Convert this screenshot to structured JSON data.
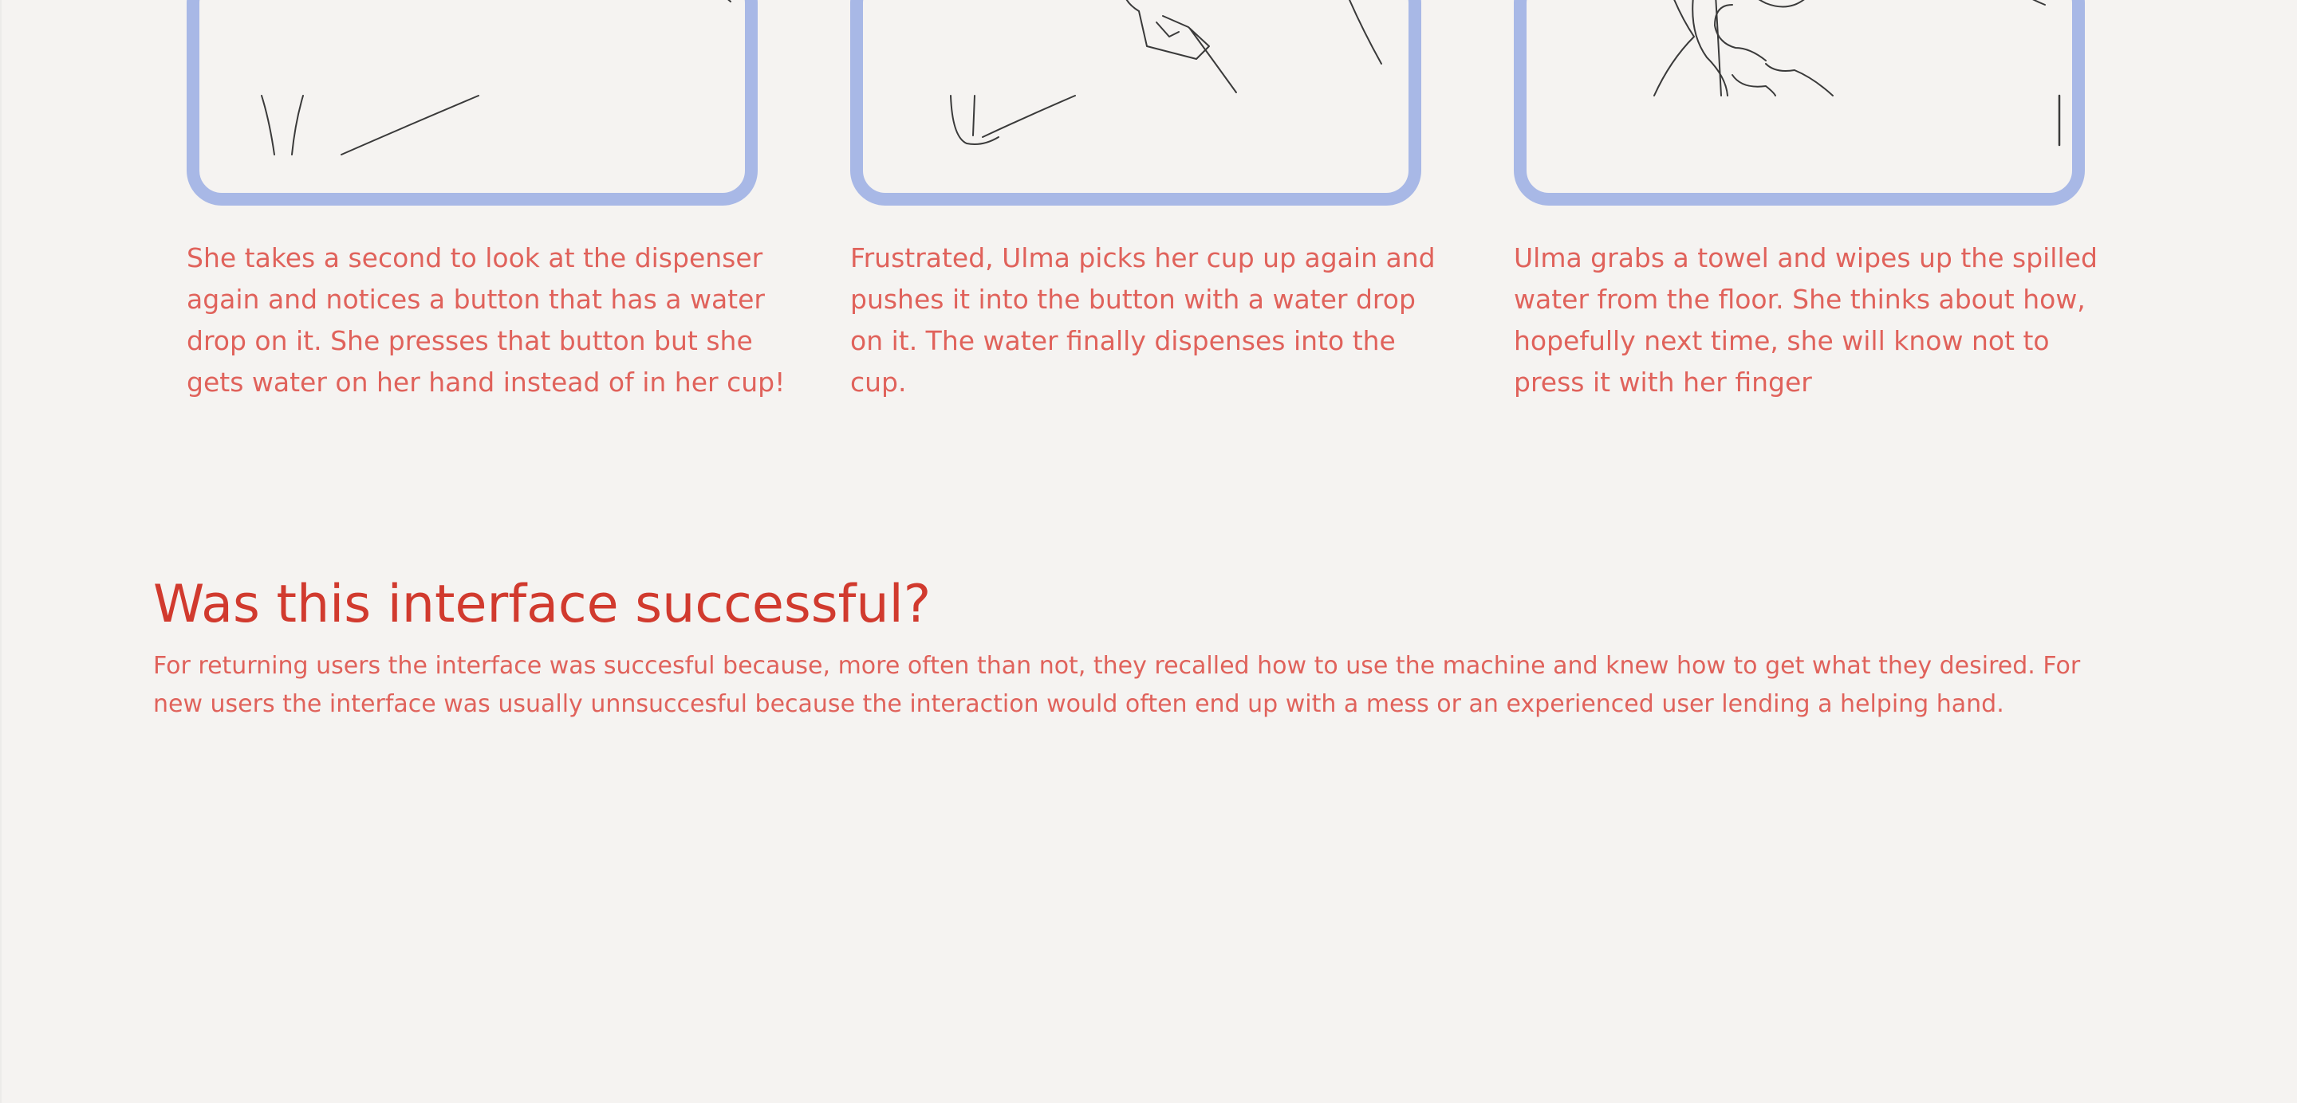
{
  "storyboard": {
    "panels": [
      {
        "caption": "She takes a second to look at the dispenser again and notices a button that has a water drop on it. She presses that button but she gets water on her hand instead of in her cup!"
      },
      {
        "caption": "Frustrated, Ulma picks her cup up again and pushes it into the button with a water drop on it. The water finally dispenses into the cup."
      },
      {
        "caption": "Ulma grabs a towel and wipes up the spilled water from the floor. She thinks about how, hopefully next time, she will know not to press it with her finger"
      }
    ]
  },
  "evaluation": {
    "title": "Was this interface successful?",
    "body": "For returning users the interface was succesful because, more often than not, they recalled how to use the machine and knew how to get what they desired. For new users the interface was usually unnsuccesful because the interaction would often end up with a mess or an experienced user lending a helping hand."
  },
  "colors": {
    "background": "#f5f3f1",
    "panel_border": "#a8b8e6",
    "heading": "#d13a2e",
    "text": "#e0625b",
    "sketch_line": "#3a3a3a"
  }
}
